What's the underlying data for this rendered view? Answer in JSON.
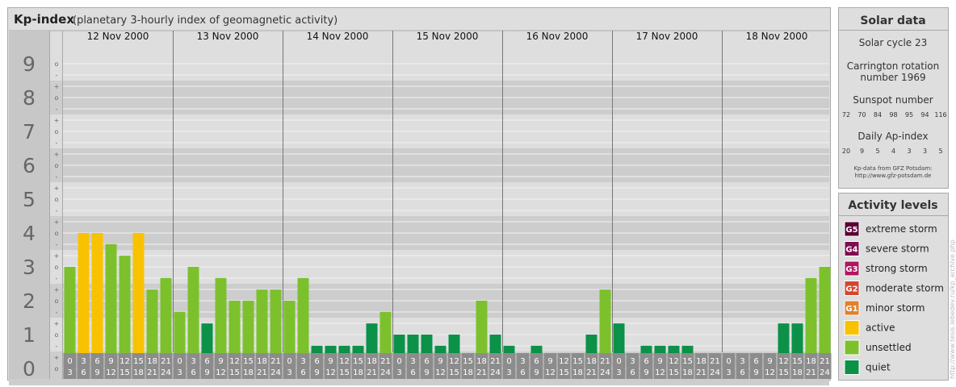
{
  "header": {
    "title": "Kp-index",
    "subtitle": "(planetary 3-hourly index of geomagnetic activity)"
  },
  "colors": {
    "quiet": "#0b9148",
    "unsettled": "#7cc12c",
    "active": "#f9c200",
    "G1": "#e0822a",
    "G2": "#d6452e",
    "G3": "#b2155f",
    "G4": "#800d52",
    "G5": "#5a0033"
  },
  "chart_data": {
    "type": "bar",
    "ylim": [
      0,
      9
    ],
    "y_ticks": [
      "0",
      "1",
      "2",
      "3",
      "4",
      "5",
      "6",
      "7",
      "8",
      "9"
    ],
    "minor_tick_labels": [
      "o",
      "-",
      "+"
    ],
    "days": [
      "12 Nov 2000",
      "13 Nov 2000",
      "14 Nov 2000",
      "15 Nov 2000",
      "16 Nov 2000",
      "17 Nov 2000",
      "18 Nov 2000"
    ],
    "slot_labels_top": [
      "0",
      "3",
      "6",
      "9",
      "12",
      "15",
      "18",
      "21"
    ],
    "slot_labels_bottom": [
      "3",
      "6",
      "9",
      "12",
      "15",
      "18",
      "21",
      "24"
    ],
    "values": [
      3.0,
      4.0,
      4.0,
      3.67,
      3.33,
      4.0,
      2.33,
      2.67,
      1.67,
      3.0,
      1.33,
      2.67,
      2.0,
      2.0,
      2.33,
      2.33,
      2.0,
      2.67,
      0.67,
      0.67,
      0.67,
      0.67,
      1.33,
      1.67,
      1.0,
      1.0,
      1.0,
      0.67,
      1.0,
      0.33,
      2.0,
      1.0,
      0.67,
      0.0,
      0.67,
      0.0,
      0.33,
      0.0,
      1.0,
      2.33,
      1.33,
      0.33,
      0.67,
      0.67,
      0.67,
      0.67,
      0.33,
      0.0,
      0.0,
      0.0,
      0.0,
      0.33,
      1.33,
      1.33,
      2.67,
      3.0
    ]
  },
  "solar": {
    "title": "Solar data",
    "cycle": "Solar cycle 23",
    "carrington_line1": "Carrington rotation",
    "carrington_line2": "number 1969",
    "sunspot_title": "Sunspot number",
    "sunspots": [
      "72",
      "70",
      "84",
      "98",
      "95",
      "94",
      "116"
    ],
    "ap_title": "Daily Ap-index",
    "ap": [
      "20",
      "9",
      "5",
      "4",
      "3",
      "3",
      "5"
    ],
    "source_line1": "Kp-data from GFZ Potsdam:",
    "source_line2": "http://www.gfz-potsdam.de"
  },
  "legend": {
    "title": "Activity levels",
    "items": [
      {
        "badge": "G5",
        "label": "extreme storm",
        "color": "#5a0033"
      },
      {
        "badge": "G4",
        "label": "severe storm",
        "color": "#800d52"
      },
      {
        "badge": "G3",
        "label": "strong storm",
        "color": "#b2155f"
      },
      {
        "badge": "G2",
        "label": "moderate storm",
        "color": "#d6452e"
      },
      {
        "badge": "G1",
        "label": "minor storm",
        "color": "#e0822a"
      },
      {
        "badge": "",
        "label": "active",
        "color": "#f9c200"
      },
      {
        "badge": "",
        "label": "unsettled",
        "color": "#7cc12c"
      },
      {
        "badge": "",
        "label": "quiet",
        "color": "#0b9148"
      }
    ]
  },
  "credit": "http://www.tesis.lebedev.ru/kp_archive.php"
}
